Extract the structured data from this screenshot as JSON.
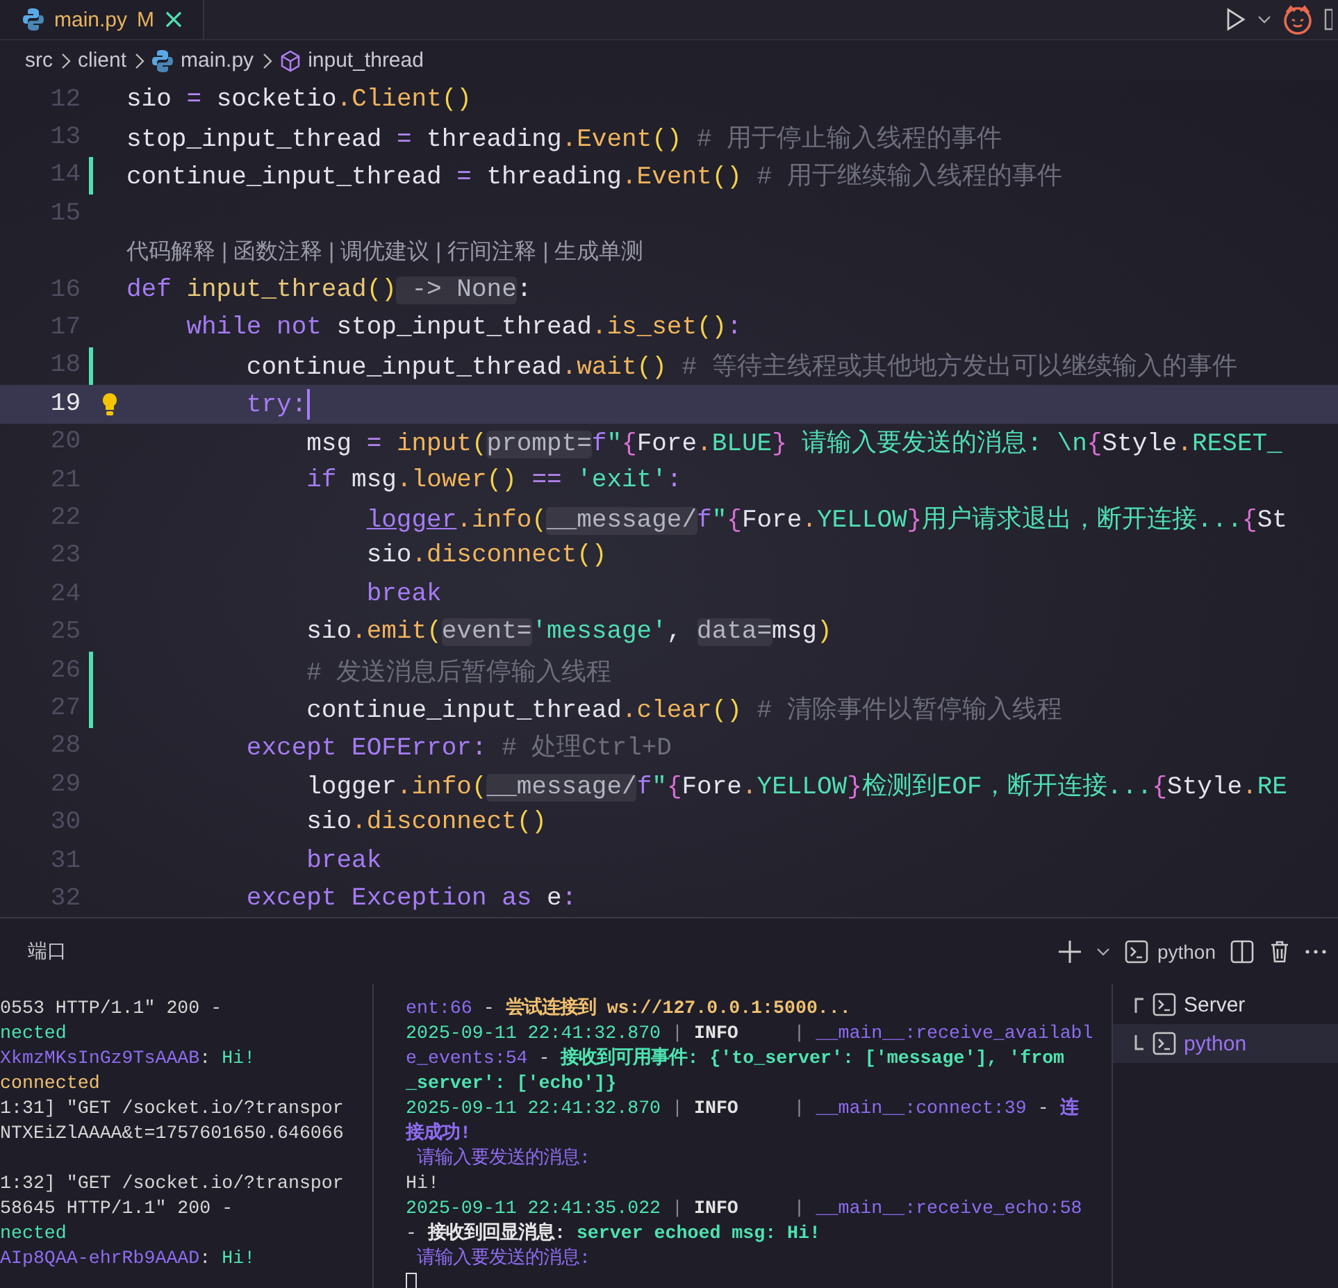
{
  "editor_tab": {
    "filename": "main.py",
    "status": "M",
    "selected": true
  },
  "breadcrumbs": [
    {
      "label": "src",
      "kind": "folder"
    },
    {
      "label": "client",
      "kind": "folder"
    },
    {
      "label": "main.py",
      "kind": "file"
    },
    {
      "label": "input_thread",
      "kind": "symbol"
    }
  ],
  "code_lines": [
    {
      "kind": "code",
      "number": "12",
      "modified": false,
      "current": false,
      "tokens": [
        {
          "kind": "id",
          "text": "sio "
        },
        {
          "kind": "op",
          "text": "="
        },
        {
          "kind": "id",
          "text": " socketio"
        },
        {
          "kind": "punc",
          "text": "."
        },
        {
          "kind": "fn",
          "text": "Client"
        },
        {
          "kind": "paren",
          "text": "()"
        }
      ]
    },
    {
      "kind": "code",
      "number": "13",
      "modified": false,
      "current": false,
      "tokens": [
        {
          "kind": "id",
          "text": "stop_input_thread "
        },
        {
          "kind": "op",
          "text": "="
        },
        {
          "kind": "id",
          "text": " threading"
        },
        {
          "kind": "punc",
          "text": "."
        },
        {
          "kind": "fn",
          "text": "Event"
        },
        {
          "kind": "paren",
          "text": "()"
        },
        {
          "kind": "cm",
          "text": " # 用于停止输入线程的事件"
        }
      ]
    },
    {
      "kind": "code",
      "number": "14",
      "modified": true,
      "current": false,
      "tokens": [
        {
          "kind": "id",
          "text": "continue_input_thread "
        },
        {
          "kind": "op",
          "text": "="
        },
        {
          "kind": "id",
          "text": " threading"
        },
        {
          "kind": "punc",
          "text": "."
        },
        {
          "kind": "fn",
          "text": "Event"
        },
        {
          "kind": "paren",
          "text": "()"
        },
        {
          "kind": "cm",
          "text": " # 用于继续输入线程的事件"
        }
      ]
    },
    {
      "kind": "code",
      "number": "15",
      "modified": false,
      "current": false
    },
    {
      "kind": "lens",
      "text": "代码解释 | 函数注释 | 调优建议 | 行间注释 | 生成单测"
    },
    {
      "kind": "code",
      "number": "16",
      "modified": false,
      "current": false,
      "tokens": [
        {
          "kind": "kw",
          "text": "def"
        },
        {
          "kind": "def",
          "text": " input_thread"
        },
        {
          "kind": "paren",
          "text": "()"
        },
        {
          "kind": "hint",
          "text": " -> None"
        },
        {
          "kind": "id",
          "text": ":"
        }
      ]
    },
    {
      "kind": "code",
      "number": "17",
      "modified": false,
      "current": false,
      "tokens": [
        {
          "kind": "kw",
          "text": "    while not"
        },
        {
          "kind": "id",
          "text": " stop_input_thread"
        },
        {
          "kind": "punc",
          "text": "."
        },
        {
          "kind": "fn",
          "text": "is_set"
        },
        {
          "kind": "paren",
          "text": "()"
        },
        {
          "kind": "op",
          "text": ":"
        }
      ]
    },
    {
      "kind": "code",
      "number": "18",
      "modified": true,
      "current": false,
      "tokens": [
        {
          "kind": "id",
          "text": "        continue_input_thread"
        },
        {
          "kind": "punc",
          "text": "."
        },
        {
          "kind": "fn",
          "text": "wait"
        },
        {
          "kind": "paren",
          "text": "()"
        },
        {
          "kind": "cm",
          "text": " # 等待主线程或其他地方发出可以继续输入的事件"
        }
      ]
    },
    {
      "kind": "code",
      "number": "19",
      "modified": false,
      "current": true,
      "tokens": [
        {
          "kind": "kw",
          "text": "        try"
        },
        {
          "kind": "op",
          "text": ":"
        }
      ]
    },
    {
      "kind": "code",
      "number": "20",
      "modified": false,
      "current": false,
      "tokens": [
        {
          "kind": "id",
          "text": "            msg "
        },
        {
          "kind": "op",
          "text": "="
        },
        {
          "kind": "fn",
          "text": " input"
        },
        {
          "kind": "paren",
          "text": "("
        },
        {
          "kind": "hint",
          "text": "prompt="
        },
        {
          "kind": "fstr",
          "text": "f"
        },
        {
          "kind": "str",
          "text": "\""
        },
        {
          "kind": "brace",
          "text": "{"
        },
        {
          "kind": "id",
          "text": "Fore"
        },
        {
          "kind": "punc",
          "text": "."
        },
        {
          "kind": "attr",
          "text": "BLUE"
        },
        {
          "kind": "brace",
          "text": "}"
        },
        {
          "kind": "str",
          "text": " 请输入要发送的消息: "
        },
        {
          "kind": "esc",
          "text": "\\n"
        },
        {
          "kind": "brace",
          "text": "{"
        },
        {
          "kind": "id",
          "text": "Style"
        },
        {
          "kind": "punc",
          "text": "."
        },
        {
          "kind": "attr",
          "text": "RESET_"
        }
      ]
    },
    {
      "kind": "code",
      "number": "21",
      "modified": false,
      "current": false,
      "tokens": [
        {
          "kind": "kw",
          "text": "            if"
        },
        {
          "kind": "id",
          "text": " msg"
        },
        {
          "kind": "punc",
          "text": "."
        },
        {
          "kind": "fn",
          "text": "lower"
        },
        {
          "kind": "paren",
          "text": "()"
        },
        {
          "kind": "op",
          "text": " =="
        },
        {
          "kind": "str",
          "text": " 'exit'"
        },
        {
          "kind": "op",
          "text": ":"
        }
      ]
    },
    {
      "kind": "code",
      "number": "22",
      "modified": false,
      "current": false,
      "tokens": [
        {
          "kind": "link",
          "text": "                logger"
        },
        {
          "kind": "punc",
          "text": "."
        },
        {
          "kind": "fn",
          "text": "info"
        },
        {
          "kind": "paren",
          "text": "("
        },
        {
          "kind": "hint",
          "text": "__message/"
        },
        {
          "kind": "fstr",
          "text": "f"
        },
        {
          "kind": "str",
          "text": "\""
        },
        {
          "kind": "brace",
          "text": "{"
        },
        {
          "kind": "id",
          "text": "Fore"
        },
        {
          "kind": "punc",
          "text": "."
        },
        {
          "kind": "attr",
          "text": "YELLOW"
        },
        {
          "kind": "brace",
          "text": "}"
        },
        {
          "kind": "str",
          "text": "用户请求退出，断开连接..."
        },
        {
          "kind": "brace",
          "text": "{"
        },
        {
          "kind": "id",
          "text": "St"
        }
      ]
    },
    {
      "kind": "code",
      "number": "23",
      "modified": false,
      "current": false,
      "tokens": [
        {
          "kind": "id",
          "text": "                sio"
        },
        {
          "kind": "punc",
          "text": "."
        },
        {
          "kind": "fn",
          "text": "disconnect"
        },
        {
          "kind": "paren",
          "text": "()"
        }
      ]
    },
    {
      "kind": "code",
      "number": "24",
      "modified": false,
      "current": false,
      "tokens": [
        {
          "kind": "kw",
          "text": "                break"
        }
      ]
    },
    {
      "kind": "code",
      "number": "25",
      "modified": false,
      "current": false,
      "tokens": [
        {
          "kind": "id",
          "text": "            sio"
        },
        {
          "kind": "punc",
          "text": "."
        },
        {
          "kind": "fn",
          "text": "emit"
        },
        {
          "kind": "paren",
          "text": "("
        },
        {
          "kind": "hint",
          "text": "event="
        },
        {
          "kind": "str",
          "text": "'message'"
        },
        {
          "kind": "id",
          "text": ", "
        },
        {
          "kind": "hint",
          "text": "data="
        },
        {
          "kind": "id",
          "text": "msg"
        },
        {
          "kind": "paren",
          "text": ")"
        }
      ]
    },
    {
      "kind": "code",
      "number": "26",
      "modified": true,
      "current": false,
      "tokens": [
        {
          "kind": "cm",
          "text": "            # 发送消息后暂停输入线程"
        }
      ]
    },
    {
      "kind": "code",
      "number": "27",
      "modified": true,
      "current": false,
      "tokens": [
        {
          "kind": "id",
          "text": "            continue_input_thread"
        },
        {
          "kind": "punc",
          "text": "."
        },
        {
          "kind": "fn",
          "text": "clear"
        },
        {
          "kind": "paren",
          "text": "()"
        },
        {
          "kind": "cm",
          "text": " # 清除事件以暂停输入线程"
        }
      ]
    },
    {
      "kind": "code",
      "number": "28",
      "modified": false,
      "current": false,
      "tokens": [
        {
          "kind": "kw",
          "text": "        except"
        },
        {
          "kind": "cls",
          "text": " EOFError"
        },
        {
          "kind": "op",
          "text": ":"
        },
        {
          "kind": "cm",
          "text": " # 处理Ctrl+D"
        }
      ]
    },
    {
      "kind": "code",
      "number": "29",
      "modified": false,
      "current": false,
      "tokens": [
        {
          "kind": "id",
          "text": "            logger"
        },
        {
          "kind": "punc",
          "text": "."
        },
        {
          "kind": "fn",
          "text": "info"
        },
        {
          "kind": "paren",
          "text": "("
        },
        {
          "kind": "hint",
          "text": "__message/"
        },
        {
          "kind": "fstr",
          "text": "f"
        },
        {
          "kind": "str",
          "text": "\""
        },
        {
          "kind": "brace",
          "text": "{"
        },
        {
          "kind": "id",
          "text": "Fore"
        },
        {
          "kind": "punc",
          "text": "."
        },
        {
          "kind": "attr",
          "text": "YELLOW"
        },
        {
          "kind": "brace",
          "text": "}"
        },
        {
          "kind": "str",
          "text": "检测到EOF，断开连接..."
        },
        {
          "kind": "brace",
          "text": "{"
        },
        {
          "kind": "id",
          "text": "Style"
        },
        {
          "kind": "punc",
          "text": "."
        },
        {
          "kind": "attr",
          "text": "RE"
        }
      ]
    },
    {
      "kind": "code",
      "number": "30",
      "modified": false,
      "current": false,
      "tokens": [
        {
          "kind": "id",
          "text": "            sio"
        },
        {
          "kind": "punc",
          "text": "."
        },
        {
          "kind": "fn",
          "text": "disconnect"
        },
        {
          "kind": "paren",
          "text": "()"
        }
      ]
    },
    {
      "kind": "code",
      "number": "31",
      "modified": false,
      "current": false,
      "tokens": [
        {
          "kind": "kw",
          "text": "            break"
        }
      ]
    },
    {
      "kind": "code",
      "number": "32",
      "modified": false,
      "current": false,
      "tokens": [
        {
          "kind": "kw",
          "text": "        except"
        },
        {
          "kind": "cls",
          "text": " Exception"
        },
        {
          "kind": "kw",
          "text": " as"
        },
        {
          "kind": "id",
          "text": " e"
        },
        {
          "kind": "op",
          "text": ":"
        }
      ]
    }
  ],
  "panel": {
    "tab": "端口",
    "shell_label": "python"
  },
  "server_output": [
    {
      "kind": "text",
      "segments": [
        {
          "kind": "plain",
          "text": "0553 HTTP/1.1\" 200 -"
        }
      ]
    },
    {
      "kind": "text",
      "segments": [
        {
          "kind": "time",
          "text": "nected"
        }
      ]
    },
    {
      "kind": "text",
      "segments": [
        {
          "kind": "source",
          "text": "XkmzMKsInGz9TsAAAB"
        },
        {
          "kind": "plain",
          "text": ": "
        },
        {
          "kind": "time",
          "text": "Hi!"
        }
      ]
    },
    {
      "kind": "text",
      "segments": [
        {
          "kind": "notice",
          "text": "connected"
        }
      ]
    },
    {
      "kind": "text",
      "segments": [
        {
          "kind": "plain",
          "text": "1:31] \"GET /socket.io/?transpor"
        }
      ]
    },
    {
      "kind": "text",
      "segments": [
        {
          "kind": "plain",
          "text": "NTXEiZlAAAA&t=1757601650.646066"
        }
      ]
    },
    {
      "kind": "blank"
    },
    {
      "kind": "text",
      "segments": [
        {
          "kind": "plain",
          "text": "1:32] \"GET /socket.io/?transpor"
        }
      ]
    },
    {
      "kind": "text",
      "segments": [
        {
          "kind": "plain",
          "text": "58645 HTTP/1.1\" 200 -"
        }
      ]
    },
    {
      "kind": "text",
      "segments": [
        {
          "kind": "time",
          "text": "nected"
        }
      ]
    },
    {
      "kind": "text",
      "segments": [
        {
          "kind": "source",
          "text": "AIp8QAA-ehrRb9AAAD"
        },
        {
          "kind": "plain",
          "text": ": "
        },
        {
          "kind": "time",
          "text": "Hi!"
        }
      ]
    }
  ],
  "client_output": [
    {
      "kind": "text",
      "segments": [
        {
          "kind": "source",
          "text": "ent:66"
        },
        {
          "kind": "plain",
          "text": " - "
        },
        {
          "kind": "attempt",
          "text": "尝试连接到 ws://127.0.0.1:5000..."
        }
      ]
    },
    {
      "kind": "text",
      "segments": [
        {
          "kind": "time",
          "text": "2025-09-11 22:41:32.870"
        },
        {
          "kind": "sep",
          "text": " | "
        },
        {
          "kind": "level",
          "text": "INFO"
        },
        {
          "kind": "sep",
          "text": "     | "
        },
        {
          "kind": "source",
          "text": "__main__:receive_availabl"
        }
      ]
    },
    {
      "kind": "text",
      "segments": [
        {
          "kind": "source",
          "text": "e_events:54"
        },
        {
          "kind": "plain",
          "text": " - "
        },
        {
          "kind": "success",
          "text": "接收到可用事件: {'to_server': ['message'], 'from"
        }
      ]
    },
    {
      "kind": "text",
      "segments": [
        {
          "kind": "success",
          "text": "_server': ['echo']}"
        }
      ]
    },
    {
      "kind": "text",
      "segments": [
        {
          "kind": "time",
          "text": "2025-09-11 22:41:32.870"
        },
        {
          "kind": "sep",
          "text": " | "
        },
        {
          "kind": "level",
          "text": "INFO"
        },
        {
          "kind": "sep",
          "text": "     | "
        },
        {
          "kind": "source",
          "text": "__main__:connect:39"
        },
        {
          "kind": "plain",
          "text": " - "
        },
        {
          "kind": "connected",
          "text": "连"
        }
      ]
    },
    {
      "kind": "text",
      "segments": [
        {
          "kind": "connected",
          "text": "接成功!"
        }
      ]
    },
    {
      "kind": "text",
      "segments": [
        {
          "kind": "prompt",
          "text": " 请输入要发送的消息:"
        }
      ]
    },
    {
      "kind": "text",
      "segments": [
        {
          "kind": "plain",
          "text": "Hi!"
        }
      ]
    },
    {
      "kind": "text",
      "segments": [
        {
          "kind": "time",
          "text": "2025-09-11 22:41:35.022"
        },
        {
          "kind": "sep",
          "text": " | "
        },
        {
          "kind": "level",
          "text": "INFO"
        },
        {
          "kind": "sep",
          "text": "     | "
        },
        {
          "kind": "source",
          "text": "__main__:receive_echo:58"
        }
      ]
    },
    {
      "kind": "text",
      "segments": [
        {
          "kind": "plain",
          "text": "- "
        },
        {
          "kind": "emph",
          "text": "接收到回显消息: "
        },
        {
          "kind": "success",
          "text": "server echoed msg: Hi!"
        }
      ]
    },
    {
      "kind": "text",
      "segments": [
        {
          "kind": "prompt",
          "text": " 请输入要发送的消息:"
        }
      ]
    },
    {
      "kind": "cursor"
    }
  ],
  "terminals": [
    {
      "name": "Server",
      "selected": false
    },
    {
      "name": "python",
      "selected": true
    }
  ]
}
